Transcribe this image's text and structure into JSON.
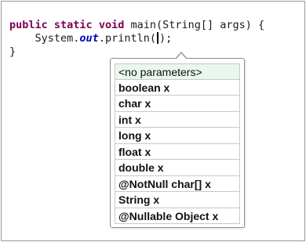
{
  "code": {
    "line1": {
      "kw1": "public",
      "kw2": "static",
      "kw3": "void",
      "rest": " main(String[] args) {"
    },
    "line2": {
      "indent": "    ",
      "prefix": "System.",
      "field": "out",
      "method": ".println(",
      "suffix": ");"
    },
    "line3": "}"
  },
  "param_popup": {
    "items": [
      "<no parameters>",
      "boolean x",
      "char x",
      "int x",
      "long x",
      "float x",
      "double x",
      "@NotNull char[] x",
      "String x",
      "@Nullable Object x"
    ]
  }
}
